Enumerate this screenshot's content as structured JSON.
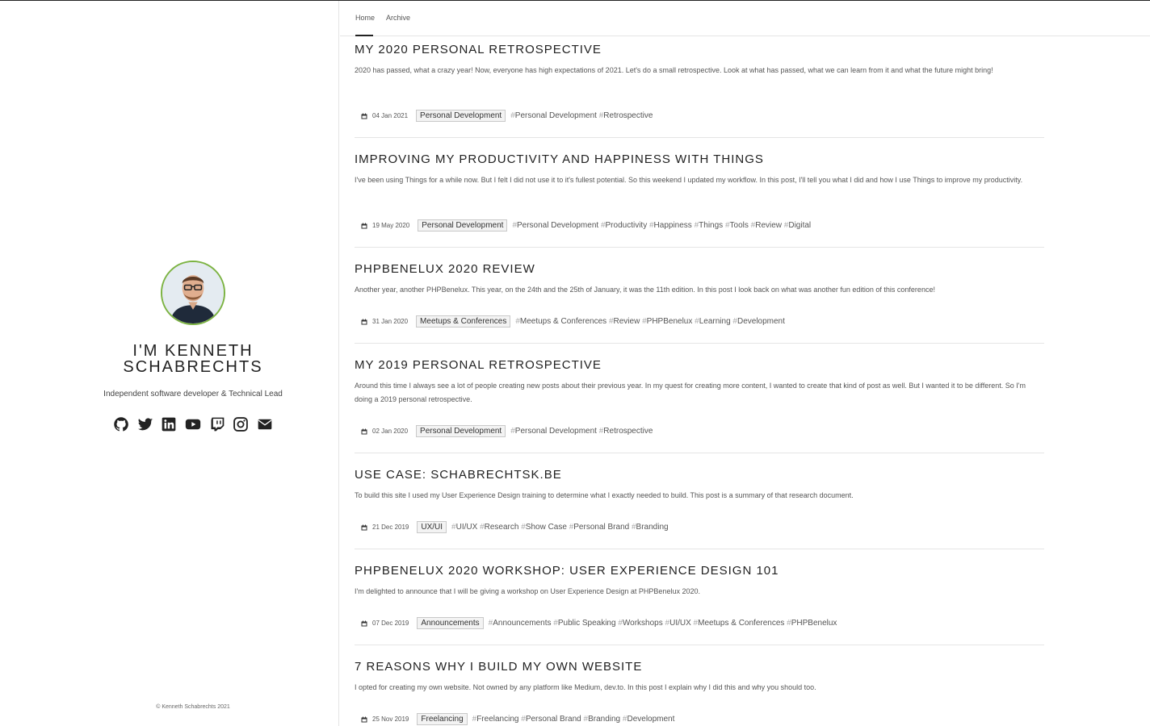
{
  "profile": {
    "name_line1": "I'M KENNETH",
    "name_line2": "SCHABRECHTS",
    "tagline": "Independent software developer & Technical Lead",
    "footer": "© Kenneth Schabrechts 2021",
    "accent_color": "#7cb342",
    "socials": [
      "github-icon",
      "twitter-icon",
      "linkedin-icon",
      "youtube-icon",
      "twitch-icon",
      "instagram-icon",
      "email-icon"
    ]
  },
  "nav": {
    "home": "Home",
    "archive": "Archive",
    "active": "Home"
  },
  "posts": [
    {
      "title": "MY 2020 PERSONAL RETROSPECTIVE",
      "excerpt": "2020 has passed, what a crazy year! Now, everyone has high expectations of 2021. Let's do a small retrospective. Look at what has passed, what we can learn from it and what the future might bring!",
      "date": "04 Jan 2021",
      "category": "Personal Development",
      "tags": [
        "Personal Development",
        "Retrospective"
      ]
    },
    {
      "title": "IMPROVING MY PRODUCTIVITY AND HAPPINESS WITH THINGS",
      "excerpt": "I've been using Things for a while now. But I felt I did not use it to it's fullest potential. So this weekend I updated my workflow. In this post, I'll tell you what I did and how I use Things to improve my productivity.",
      "date": "19 May 2020",
      "category": "Personal Development",
      "tags": [
        "Personal Development",
        "Productivity",
        "Happiness",
        "Things",
        "Tools",
        "Review",
        "Digital"
      ]
    },
    {
      "title": "PHPBENELUX 2020 REVIEW",
      "excerpt": "Another year, another PHPBenelux. This year, on the 24th and the 25th of January, it was the 11th edition. In this post I look back on what was another fun edition of this conference!",
      "date": "31 Jan 2020",
      "category": "Meetups & Conferences",
      "tags": [
        "Meetups & Conferences",
        "Review",
        "PHPBenelux",
        "Learning",
        "Development"
      ]
    },
    {
      "title": "MY 2019 PERSONAL RETROSPECTIVE",
      "excerpt": "Around this time I always see a lot of people creating new posts about their previous year. In my quest for creating more content, I wanted to create that kind of post as well. But I wanted it to be different. So I'm doing a 2019 personal retrospective.",
      "date": "02 Jan 2020",
      "category": "Personal Development",
      "tags": [
        "Personal Development",
        "Retrospective"
      ]
    },
    {
      "title": "USE CASE: SCHABRECHTSK.BE",
      "excerpt": "To build this site I used my User Experience Design training to determine what I exactly needed to build. This post is a summary of that research document.",
      "date": "21 Dec 2019",
      "category": "UX/UI",
      "tags": [
        "UI/UX",
        "Research",
        "Show Case",
        "Personal Brand",
        "Branding"
      ]
    },
    {
      "title": "PHPBENELUX 2020 WORKSHOP: USER EXPERIENCE DESIGN 101",
      "excerpt": "I'm delighted to announce that I will be giving a workshop on User Experience Design at PHPBenelux 2020.",
      "date": "07 Dec 2019",
      "category": "Announcements",
      "tags": [
        "Announcements",
        "Public Speaking",
        "Workshops",
        "UI/UX",
        "Meetups & Conferences",
        "PHPBenelux"
      ]
    },
    {
      "title": "7 REASONS WHY I BUILD MY OWN WEBSITE",
      "excerpt": "I opted for creating my own website. Not owned by any platform like Medium, dev.to. In this post I explain why I did this and why you should too.",
      "date": "25 Nov 2019",
      "category": "Freelancing",
      "tags": [
        "Freelancing",
        "Personal Brand",
        "Branding",
        "Development"
      ]
    }
  ]
}
